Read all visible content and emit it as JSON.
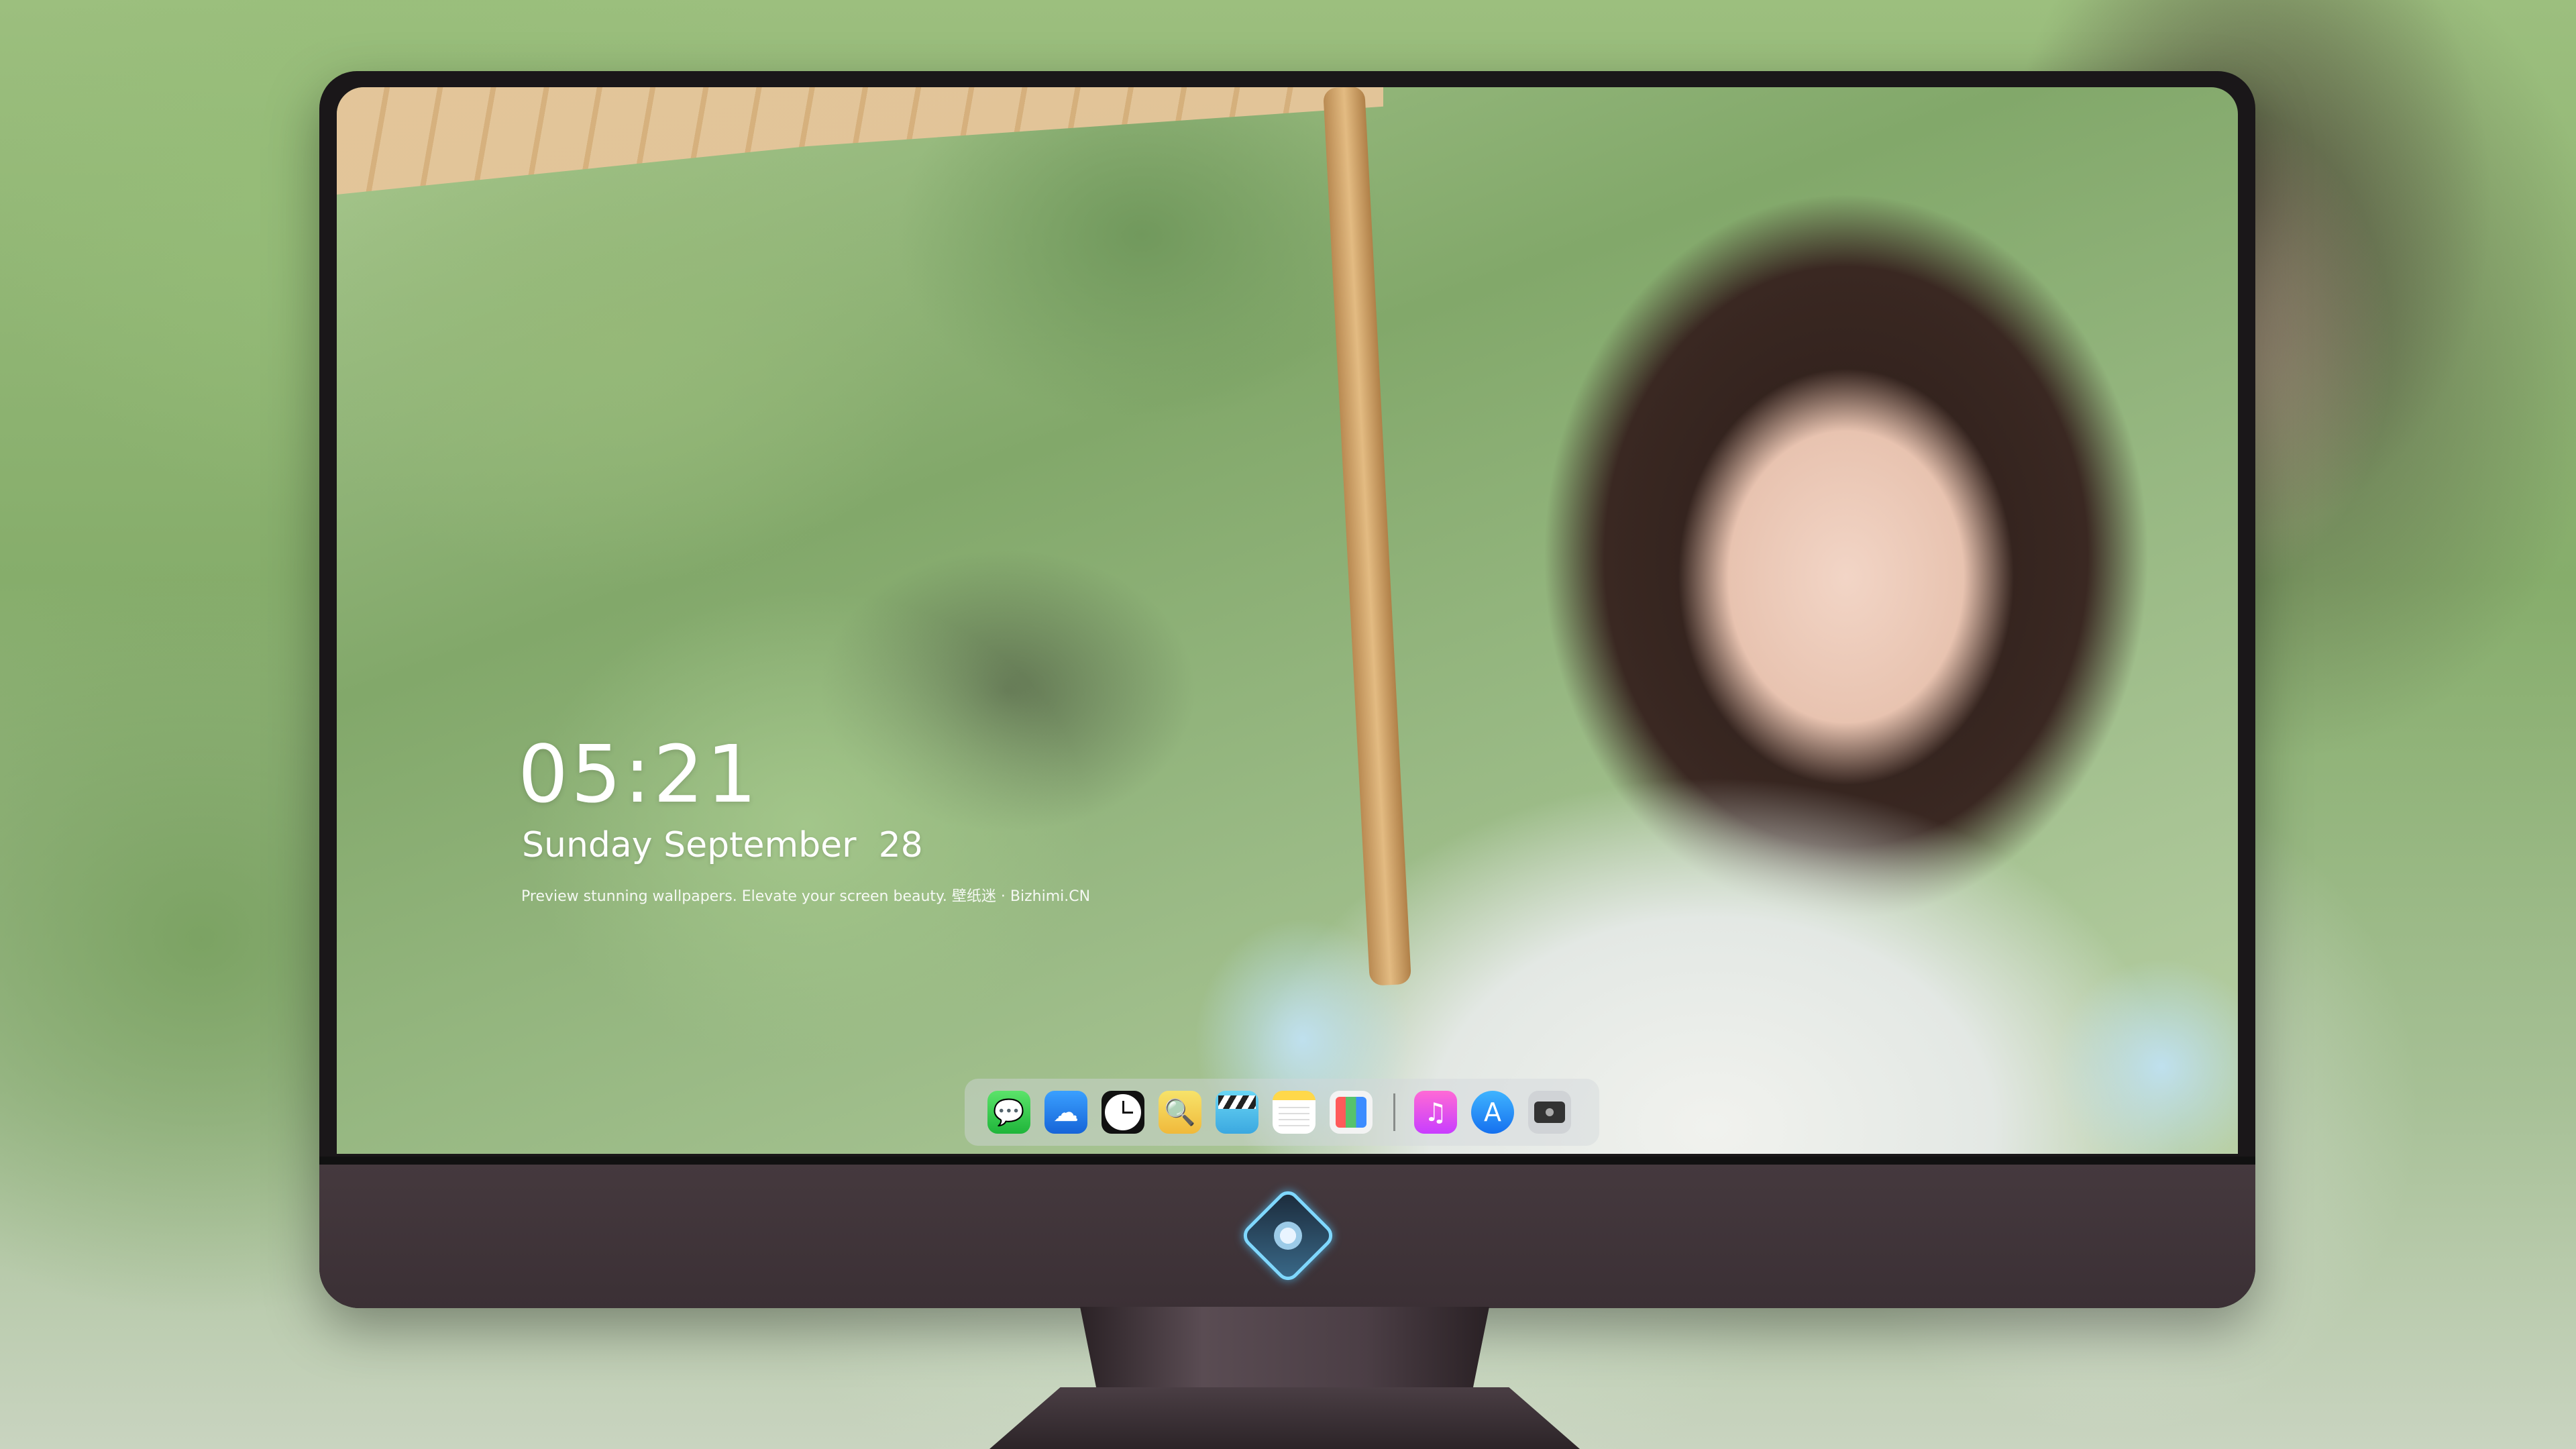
{
  "lockscreen": {
    "time": "05:21",
    "date": "Sunday September  28",
    "tagline": "Preview stunning wallpapers. Elevate your screen beauty. 壁纸迷 · Bizhimi.CN"
  },
  "dock": {
    "apps": [
      {
        "name": "messages-icon",
        "glyph": "💬"
      },
      {
        "name": "weather-icon",
        "glyph": "☁"
      },
      {
        "name": "clock-icon",
        "glyph": ""
      },
      {
        "name": "preview-icon",
        "glyph": "🔍"
      },
      {
        "name": "claquette-icon",
        "glyph": ""
      },
      {
        "name": "notes-icon",
        "glyph": ""
      },
      {
        "name": "photos-icon",
        "glyph": ""
      },
      {
        "name": "music-icon",
        "glyph": "♫"
      },
      {
        "name": "app-store-icon",
        "glyph": "A"
      },
      {
        "name": "camera-icon",
        "glyph": ""
      }
    ]
  },
  "colors": {
    "monitor_frame": "#1a1719",
    "monitor_chin": "#3f3439",
    "logo_glow": "#7fd8ff"
  }
}
